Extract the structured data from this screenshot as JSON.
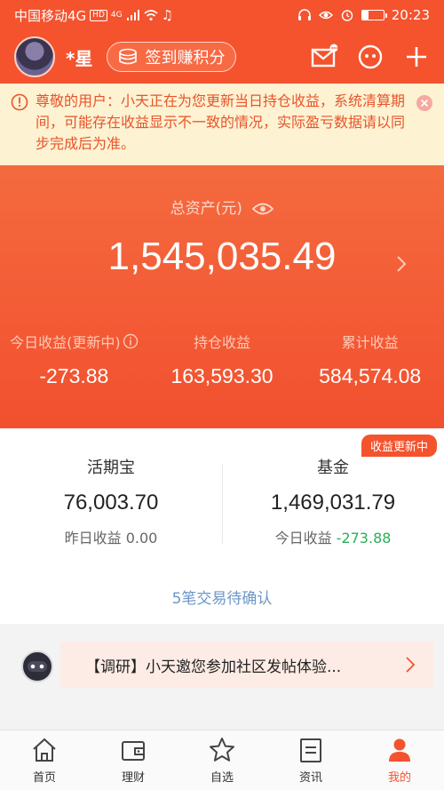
{
  "status_bar": {
    "carrier": "中国移动4G",
    "hd": "HD",
    "net": "4G",
    "time": "20:23",
    "battery_level": 0.3
  },
  "header": {
    "username": "*星",
    "signin_label": "签到赚积分"
  },
  "notice": {
    "text": "尊敬的用户：小天正在为您更新当日持仓收益，系统清算期间，可能存在收益显示不一致的情况，实际盈亏数据请以同步完成后为准。"
  },
  "assets": {
    "total_label": "总资产(元)",
    "total_value": "1,545,035.49",
    "stats": [
      {
        "label": "今日收益(更新中)",
        "value": "-273.88"
      },
      {
        "label": "持仓收益",
        "value": "163,593.30"
      },
      {
        "label": "累计收益",
        "value": "584,574.08"
      }
    ]
  },
  "funds": {
    "update_badge": "收益更新中",
    "left": {
      "title": "活期宝",
      "value": "76,003.70",
      "sub_label": "昨日收益",
      "sub_value": "0.00"
    },
    "right": {
      "title": "基金",
      "value": "1,469,031.79",
      "sub_label": "今日收益",
      "sub_value": "-273.88"
    },
    "pending": "5笔交易待确认"
  },
  "research": {
    "text": "【调研】小天邀您参加社区发帖体验..."
  },
  "tabs": [
    {
      "label": "首页",
      "icon": "home-icon"
    },
    {
      "label": "理财",
      "icon": "wallet-icon"
    },
    {
      "label": "自选",
      "icon": "star-icon"
    },
    {
      "label": "资讯",
      "icon": "news-icon"
    },
    {
      "label": "我的",
      "icon": "profile-icon"
    }
  ],
  "colors": {
    "brand": "#f4532e",
    "notice_bg": "#fdf2d2",
    "positive_green": "#2bae59",
    "link_blue": "#6c96c8"
  }
}
